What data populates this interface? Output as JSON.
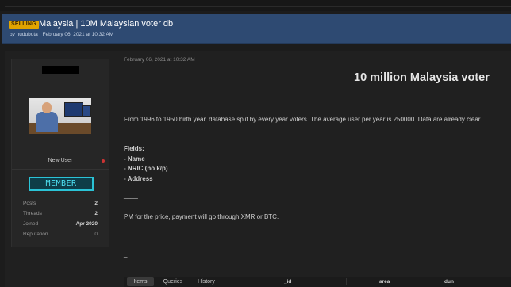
{
  "thread": {
    "badge": "SELLING",
    "title": "Malaysia | 10M Malaysian voter db",
    "byline": "by nudubota · February 06, 2021 at 10:32 AM"
  },
  "author": {
    "role": "New User",
    "badge": "MEMBER",
    "stats": [
      {
        "label": "Posts",
        "value": "2"
      },
      {
        "label": "Threads",
        "value": "2"
      },
      {
        "label": "Joined",
        "value": "Apr 2020"
      },
      {
        "label": "Reputation",
        "value": "0"
      }
    ]
  },
  "post": {
    "date": "February 06, 2021 at 10:32 AM",
    "heading": "10 million Malaysia voter",
    "intro": "From 1996 to 1950 birth year. database split by every year voters. The average user per year is 250000. Data are already clear",
    "fields_title": "Fields:",
    "fields": [
      "- Name",
      "- NRIC (no k/p)",
      "- Address"
    ],
    "separator": "____",
    "price_text": "PM for the price, payment will go through XMR or BTC.",
    "tail": "_"
  },
  "data_tabs": {
    "tabs": [
      "Items",
      "Queries",
      "History"
    ],
    "active": "Items",
    "columns": [
      "_id",
      "area",
      "dun"
    ]
  },
  "colors": {
    "header_bg": "#2e4a72",
    "badge": "#e0a400",
    "member_badge": "#2bc3d6",
    "status_dot": "#cc3333"
  }
}
